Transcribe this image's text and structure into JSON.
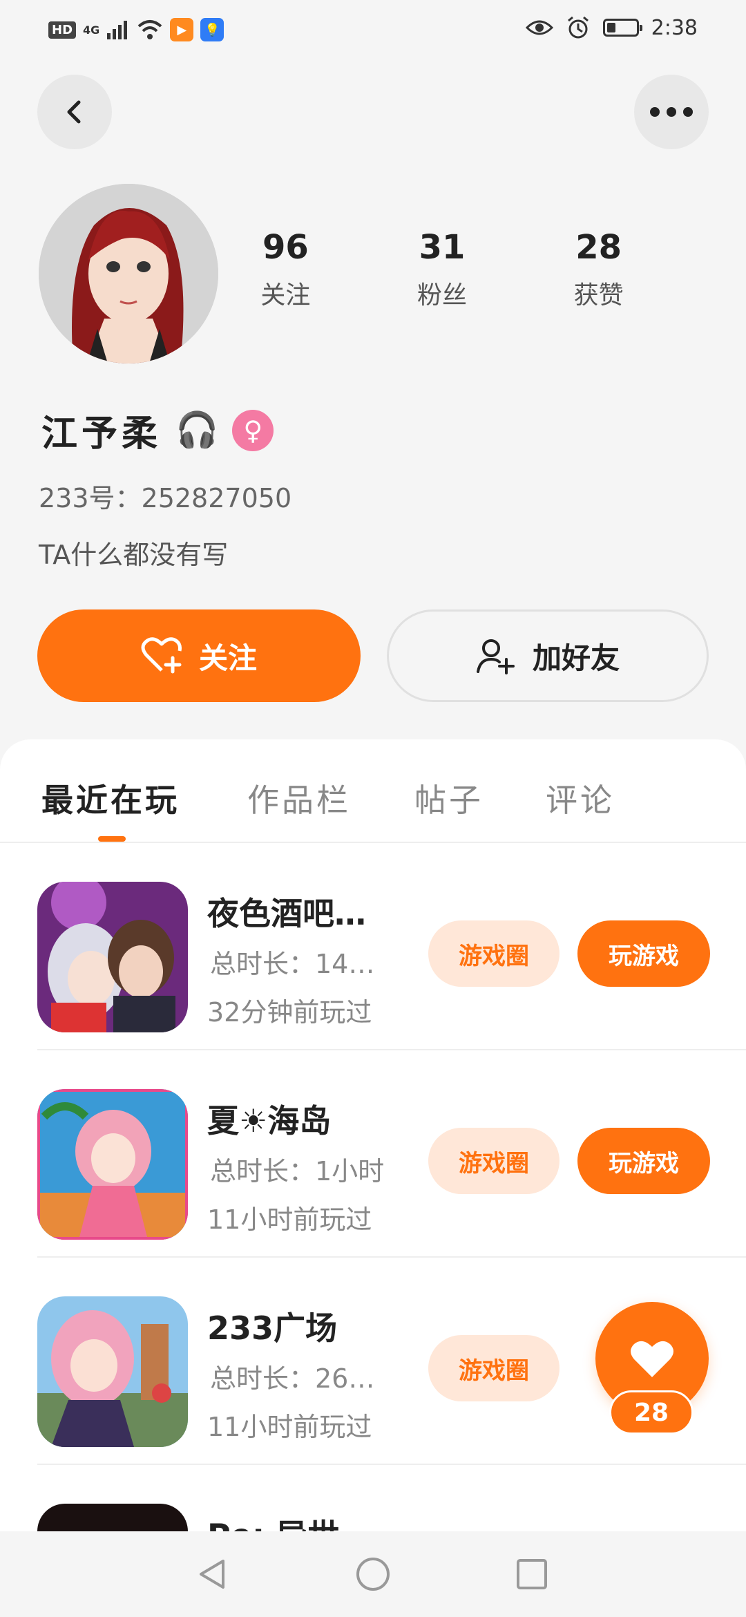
{
  "status_bar": {
    "hd_badge": "HD",
    "network": "4G",
    "time": "2:38",
    "battery_level": 0.3
  },
  "header": {
    "back_icon": "chevron-left-icon",
    "more_icon": "more-horizontal-icon"
  },
  "profile": {
    "stats": [
      {
        "value": "96",
        "label": "关注"
      },
      {
        "value": "31",
        "label": "粉丝"
      },
      {
        "value": "28",
        "label": "获赞"
      }
    ],
    "name": "江予柔",
    "name_emoji": "🎧",
    "gender_symbol": "♀",
    "id_text": "233号：252827050",
    "bio": "TA什么都没有写",
    "follow_label": "关注",
    "add_friend_label": "加好友"
  },
  "tabs": [
    {
      "label": "最近在玩",
      "active": true
    },
    {
      "label": "作品栏",
      "active": false
    },
    {
      "label": "帖子",
      "active": false
    },
    {
      "label": "评论",
      "active": false
    }
  ],
  "games": [
    {
      "title": "夜色酒吧…",
      "duration": "总时长：14…",
      "last_played": "32分钟前玩过",
      "circle_label": "游戏圈",
      "play_label": "玩游戏"
    },
    {
      "title": "夏☀海岛",
      "duration": "总时长：1小时",
      "last_played": "11小时前玩过",
      "circle_label": "游戏圈",
      "play_label": "玩游戏"
    },
    {
      "title": "233广场",
      "duration": "总时长：26…",
      "last_played": "11小时前玩过",
      "circle_label": "游戏圈",
      "play_label": ""
    },
    {
      "title": "Pe: 异世…",
      "duration": "",
      "last_played": "",
      "circle_label": "",
      "play_label": ""
    }
  ],
  "floating_like": {
    "count": "28"
  },
  "colors": {
    "accent": "#ff7210",
    "accent_light": "#ffe7d8",
    "gender_pink": "#f47aa3"
  }
}
